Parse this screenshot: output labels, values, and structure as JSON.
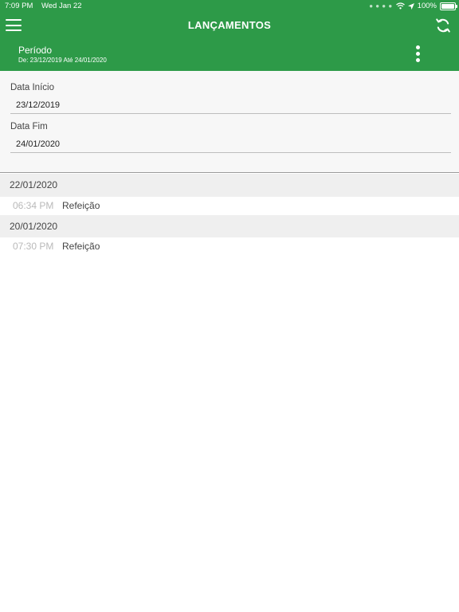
{
  "status_bar": {
    "time": "7:09 PM",
    "date": "Wed Jan 22",
    "battery": "100%"
  },
  "header": {
    "title": "LANÇAMENTOS",
    "period_label": "Período",
    "period_range": "De: 23/12/2019 Até 24/01/2020",
    "background_color": "#2d9a48",
    "icons": {
      "menu": "hamburger-menu-icon",
      "refresh": "refresh-icon",
      "more": "more-vertical-icon"
    }
  },
  "filters": {
    "start": {
      "label": "Data Início",
      "value": "23/12/2019"
    },
    "end": {
      "label": "Data Fim",
      "value": "24/01/2020"
    }
  },
  "entries": [
    {
      "date": "22/01/2020",
      "items": [
        {
          "time": "06:34 PM",
          "description": "Refeição"
        }
      ]
    },
    {
      "date": "20/01/2020",
      "items": [
        {
          "time": "07:30 PM",
          "description": "Refeição"
        }
      ]
    }
  ]
}
